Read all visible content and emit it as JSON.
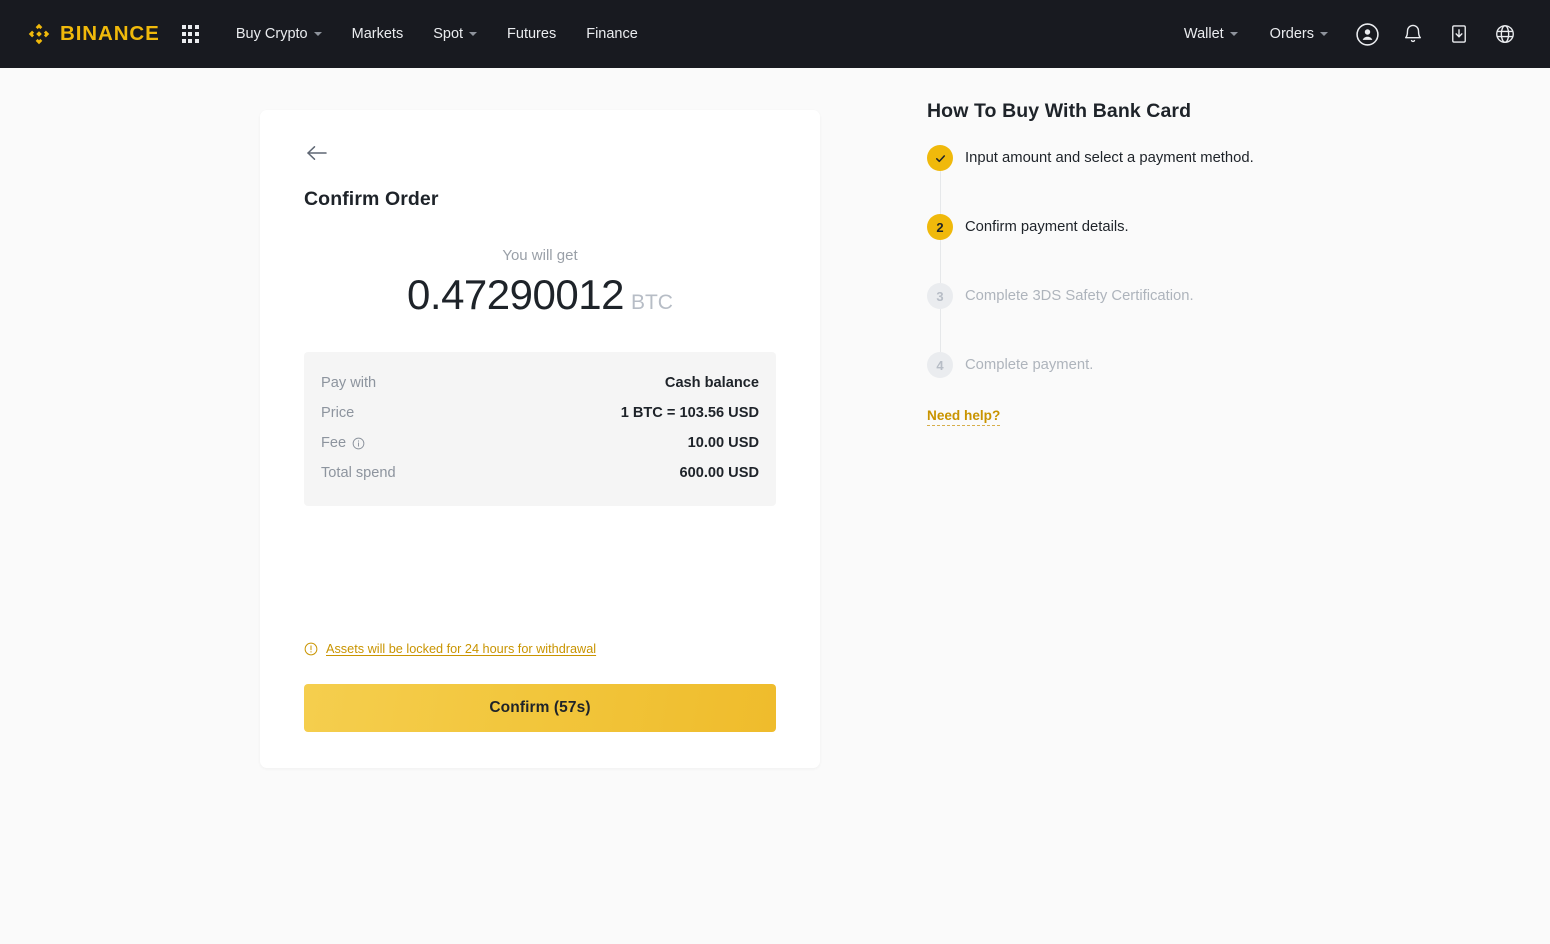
{
  "nav": {
    "brand": "BINANCE",
    "apps_icon": "apps-grid-icon",
    "items": [
      {
        "label": "Buy Crypto",
        "has_caret": true
      },
      {
        "label": "Markets",
        "has_caret": false
      },
      {
        "label": "Spot",
        "has_caret": true
      },
      {
        "label": "Futures",
        "has_caret": false
      },
      {
        "label": "Finance",
        "has_caret": false
      }
    ],
    "right_items": [
      {
        "label": "Wallet",
        "has_caret": true
      },
      {
        "label": "Orders",
        "has_caret": true
      }
    ],
    "right_icons": [
      "user-profile-icon",
      "notification-bell-icon",
      "download-app-icon",
      "language-globe-icon"
    ]
  },
  "order": {
    "back_icon": "back-arrow-icon",
    "title": "Confirm Order",
    "you_will_get_label": "You will get",
    "amount": "0.47290012",
    "currency": "BTC",
    "details": [
      {
        "label": "Pay with",
        "value": "Cash balance",
        "info": false
      },
      {
        "label": "Price",
        "value": "1 BTC = 103.56 USD",
        "info": false
      },
      {
        "label": "Fee",
        "value": "10.00 USD",
        "info": true
      },
      {
        "label": "Total spend",
        "value": "600.00 USD",
        "info": false
      }
    ],
    "lock_notice": "Assets will be locked for 24 hours for withdrawal",
    "lock_notice_icon": "warning-circle-icon",
    "confirm_label": "Confirm (57s)"
  },
  "help": {
    "title": "How To Buy With Bank Card",
    "steps": [
      {
        "marker": "✓",
        "state": "done",
        "text": "Input amount and select a payment method."
      },
      {
        "marker": "2",
        "state": "active",
        "text": "Confirm payment details."
      },
      {
        "marker": "3",
        "state": "todo",
        "text": "Complete 3DS Safety Certification."
      },
      {
        "marker": "4",
        "state": "todo",
        "text": "Complete payment."
      }
    ],
    "need_help_label": "Need help?"
  },
  "colors": {
    "brand_gold": "#F0B90B",
    "nav_background": "#181A20",
    "page_background": "#FAFAFA",
    "text_primary": "#1E2329",
    "text_muted": "#8D949E",
    "link_gold": "#C99400"
  }
}
